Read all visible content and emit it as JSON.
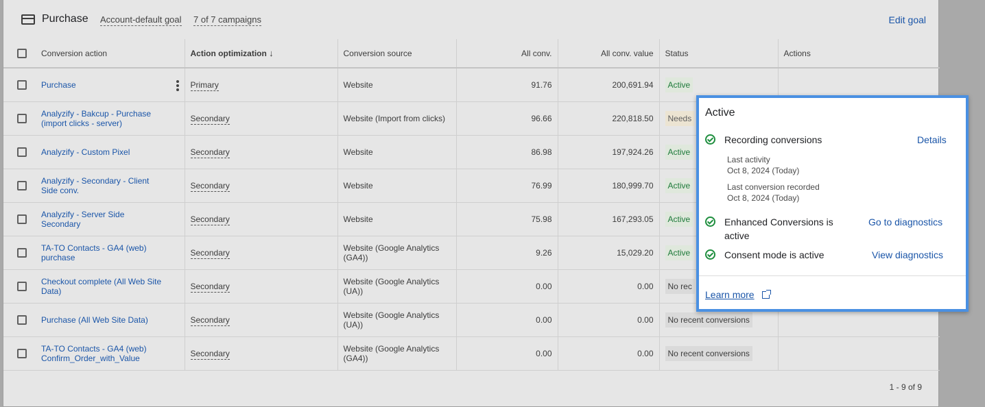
{
  "header": {
    "title": "Purchase",
    "goal_type": "Account-default goal",
    "campaigns": "7 of 7 campaigns",
    "edit_goal": "Edit goal"
  },
  "columns": {
    "conversion_action": "Conversion action",
    "action_optimization": "Action optimization",
    "conversion_source": "Conversion source",
    "all_conv": "All conv.",
    "all_conv_value": "All conv. value",
    "status": "Status",
    "actions": "Actions"
  },
  "rows": [
    {
      "name": "Purchase",
      "optimization": "Primary",
      "source": "Website",
      "conv": "91.76",
      "value": "200,691.94",
      "status": "Active"
    },
    {
      "name": "Analyzify - Bakcup - Purchase (import clicks - server)",
      "optimization": "Secondary",
      "source": "Website (Import from clicks)",
      "conv": "96.66",
      "value": "220,818.50",
      "status": "Needs"
    },
    {
      "name": "Analyzify - Custom Pixel",
      "optimization": "Secondary",
      "source": "Website",
      "conv": "86.98",
      "value": "197,924.26",
      "status": "Active"
    },
    {
      "name": "Analyzify - Secondary - Client Side conv.",
      "optimization": "Secondary",
      "source": "Website",
      "conv": "76.99",
      "value": "180,999.70",
      "status": "Active"
    },
    {
      "name": "Analyzify - Server Side Secondary",
      "optimization": "Secondary",
      "source": "Website",
      "conv": "75.98",
      "value": "167,293.05",
      "status": "Active"
    },
    {
      "name": "TA-TO Contacts - GA4 (web) purchase",
      "optimization": "Secondary",
      "source": "Website (Google Analytics (GA4))",
      "conv": "9.26",
      "value": "15,029.20",
      "status": "Active"
    },
    {
      "name": "Checkout complete (All Web Site Data)",
      "optimization": "Secondary",
      "source": "Website (Google Analytics (UA))",
      "conv": "0.00",
      "value": "0.00",
      "status": "No rec"
    },
    {
      "name": "Purchase (All Web Site Data)",
      "optimization": "Secondary",
      "source": "Website (Google Analytics (UA))",
      "conv": "0.00",
      "value": "0.00",
      "status": "No recent conversions"
    },
    {
      "name": "TA-TO Contacts - GA4 (web) Confirm_Order_with_Value",
      "optimization": "Secondary",
      "source": "Website (Google Analytics (GA4))",
      "conv": "0.00",
      "value": "0.00",
      "status": "No recent conversions"
    }
  ],
  "pagination": "1 - 9 of 9",
  "popup": {
    "title": "Active",
    "recording": "Recording conversions",
    "details": "Details",
    "last_activity_label": "Last activity",
    "last_activity_value": "Oct 8, 2024 (Today)",
    "last_conv_label": "Last conversion recorded",
    "last_conv_value": "Oct 8, 2024 (Today)",
    "enhanced_line1": "Enhanced Conversions is",
    "enhanced_line2": "active",
    "go_diag": "Go to diagnostics",
    "consent": "Consent mode is active",
    "view_diag": "View diagnostics",
    "learn_more": "Learn more"
  }
}
